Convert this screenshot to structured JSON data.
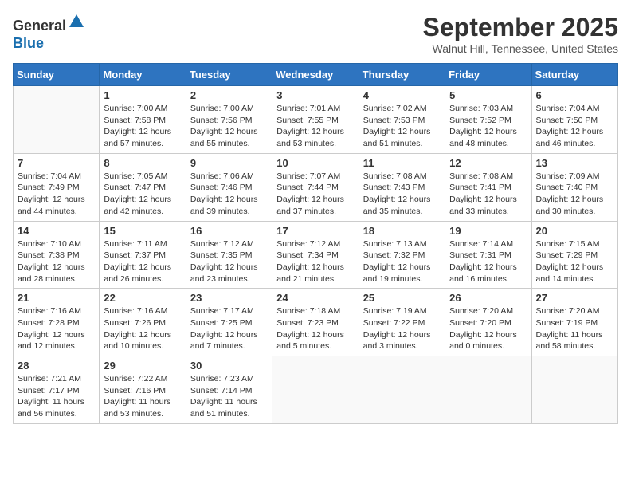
{
  "header": {
    "logo_line1": "General",
    "logo_line2": "Blue",
    "month": "September 2025",
    "location": "Walnut Hill, Tennessee, United States"
  },
  "days_of_week": [
    "Sunday",
    "Monday",
    "Tuesday",
    "Wednesday",
    "Thursday",
    "Friday",
    "Saturday"
  ],
  "weeks": [
    [
      {
        "day": "",
        "info": ""
      },
      {
        "day": "1",
        "info": "Sunrise: 7:00 AM\nSunset: 7:58 PM\nDaylight: 12 hours\nand 57 minutes."
      },
      {
        "day": "2",
        "info": "Sunrise: 7:00 AM\nSunset: 7:56 PM\nDaylight: 12 hours\nand 55 minutes."
      },
      {
        "day": "3",
        "info": "Sunrise: 7:01 AM\nSunset: 7:55 PM\nDaylight: 12 hours\nand 53 minutes."
      },
      {
        "day": "4",
        "info": "Sunrise: 7:02 AM\nSunset: 7:53 PM\nDaylight: 12 hours\nand 51 minutes."
      },
      {
        "day": "5",
        "info": "Sunrise: 7:03 AM\nSunset: 7:52 PM\nDaylight: 12 hours\nand 48 minutes."
      },
      {
        "day": "6",
        "info": "Sunrise: 7:04 AM\nSunset: 7:50 PM\nDaylight: 12 hours\nand 46 minutes."
      }
    ],
    [
      {
        "day": "7",
        "info": "Sunrise: 7:04 AM\nSunset: 7:49 PM\nDaylight: 12 hours\nand 44 minutes."
      },
      {
        "day": "8",
        "info": "Sunrise: 7:05 AM\nSunset: 7:47 PM\nDaylight: 12 hours\nand 42 minutes."
      },
      {
        "day": "9",
        "info": "Sunrise: 7:06 AM\nSunset: 7:46 PM\nDaylight: 12 hours\nand 39 minutes."
      },
      {
        "day": "10",
        "info": "Sunrise: 7:07 AM\nSunset: 7:44 PM\nDaylight: 12 hours\nand 37 minutes."
      },
      {
        "day": "11",
        "info": "Sunrise: 7:08 AM\nSunset: 7:43 PM\nDaylight: 12 hours\nand 35 minutes."
      },
      {
        "day": "12",
        "info": "Sunrise: 7:08 AM\nSunset: 7:41 PM\nDaylight: 12 hours\nand 33 minutes."
      },
      {
        "day": "13",
        "info": "Sunrise: 7:09 AM\nSunset: 7:40 PM\nDaylight: 12 hours\nand 30 minutes."
      }
    ],
    [
      {
        "day": "14",
        "info": "Sunrise: 7:10 AM\nSunset: 7:38 PM\nDaylight: 12 hours\nand 28 minutes."
      },
      {
        "day": "15",
        "info": "Sunrise: 7:11 AM\nSunset: 7:37 PM\nDaylight: 12 hours\nand 26 minutes."
      },
      {
        "day": "16",
        "info": "Sunrise: 7:12 AM\nSunset: 7:35 PM\nDaylight: 12 hours\nand 23 minutes."
      },
      {
        "day": "17",
        "info": "Sunrise: 7:12 AM\nSunset: 7:34 PM\nDaylight: 12 hours\nand 21 minutes."
      },
      {
        "day": "18",
        "info": "Sunrise: 7:13 AM\nSunset: 7:32 PM\nDaylight: 12 hours\nand 19 minutes."
      },
      {
        "day": "19",
        "info": "Sunrise: 7:14 AM\nSunset: 7:31 PM\nDaylight: 12 hours\nand 16 minutes."
      },
      {
        "day": "20",
        "info": "Sunrise: 7:15 AM\nSunset: 7:29 PM\nDaylight: 12 hours\nand 14 minutes."
      }
    ],
    [
      {
        "day": "21",
        "info": "Sunrise: 7:16 AM\nSunset: 7:28 PM\nDaylight: 12 hours\nand 12 minutes."
      },
      {
        "day": "22",
        "info": "Sunrise: 7:16 AM\nSunset: 7:26 PM\nDaylight: 12 hours\nand 10 minutes."
      },
      {
        "day": "23",
        "info": "Sunrise: 7:17 AM\nSunset: 7:25 PM\nDaylight: 12 hours\nand 7 minutes."
      },
      {
        "day": "24",
        "info": "Sunrise: 7:18 AM\nSunset: 7:23 PM\nDaylight: 12 hours\nand 5 minutes."
      },
      {
        "day": "25",
        "info": "Sunrise: 7:19 AM\nSunset: 7:22 PM\nDaylight: 12 hours\nand 3 minutes."
      },
      {
        "day": "26",
        "info": "Sunrise: 7:20 AM\nSunset: 7:20 PM\nDaylight: 12 hours\nand 0 minutes."
      },
      {
        "day": "27",
        "info": "Sunrise: 7:20 AM\nSunset: 7:19 PM\nDaylight: 11 hours\nand 58 minutes."
      }
    ],
    [
      {
        "day": "28",
        "info": "Sunrise: 7:21 AM\nSunset: 7:17 PM\nDaylight: 11 hours\nand 56 minutes."
      },
      {
        "day": "29",
        "info": "Sunrise: 7:22 AM\nSunset: 7:16 PM\nDaylight: 11 hours\nand 53 minutes."
      },
      {
        "day": "30",
        "info": "Sunrise: 7:23 AM\nSunset: 7:14 PM\nDaylight: 11 hours\nand 51 minutes."
      },
      {
        "day": "",
        "info": ""
      },
      {
        "day": "",
        "info": ""
      },
      {
        "day": "",
        "info": ""
      },
      {
        "day": "",
        "info": ""
      }
    ]
  ]
}
